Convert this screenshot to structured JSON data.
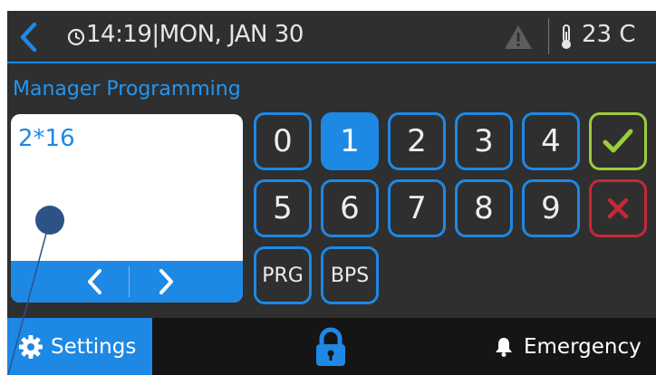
{
  "status_bar": {
    "time_date": "14:19|MON, JAN 30",
    "temperature": "23 C",
    "icons": [
      "back-chevron-icon",
      "clock-icon",
      "warning-icon",
      "thermometer-icon"
    ]
  },
  "page": {
    "title": "Manager Programming"
  },
  "display": {
    "value": "2*16"
  },
  "keypad": {
    "keys": [
      "0",
      "1",
      "2",
      "3",
      "4",
      "5",
      "6",
      "7",
      "8",
      "9",
      "PRG",
      "BPS"
    ],
    "active_key": "1",
    "confirm_icon": "checkmark-icon",
    "cancel_icon": "x-icon"
  },
  "bottom_bar": {
    "settings_label": "Settings",
    "emergency_label": "Emergency",
    "icons": [
      "gear-icon",
      "lock-icon",
      "bell-icon"
    ]
  },
  "colors": {
    "accent": "#1e88e5",
    "background": "#2f2f2f",
    "confirm": "#9ccc3c",
    "cancel": "#c62838"
  }
}
